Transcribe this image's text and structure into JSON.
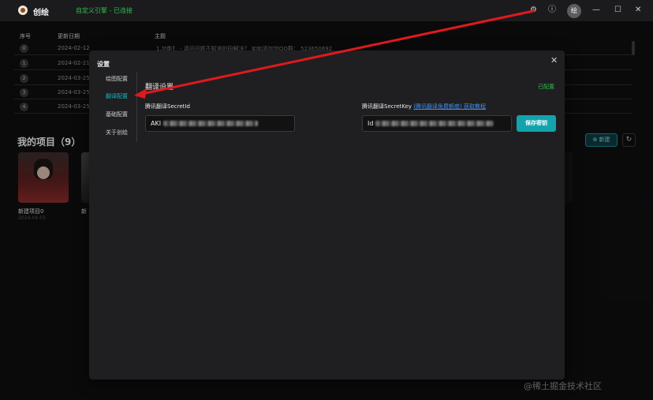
{
  "titlebar": {
    "app_title": "创绘",
    "engine_status": "自定义引擎 - 已连接",
    "avatar_label": "绘",
    "icons": [
      "gear-icon",
      "help-icon",
      "minimize-icon",
      "maximize-icon",
      "close-icon"
    ]
  },
  "table": {
    "headers": [
      "序号",
      "更新日期",
      "主题"
    ],
    "rows": [
      {
        "index": "0",
        "date": "2024-02-12",
        "topic": "1.功能】 - 请问问题不知道的码解决？ 如如添加加QQ群： 523650692"
      },
      {
        "index": "1",
        "date": "2024-02-21",
        "topic": ""
      },
      {
        "index": "2",
        "date": "2024-03-25",
        "topic": ""
      },
      {
        "index": "3",
        "date": "2024-03-25",
        "topic": ""
      },
      {
        "index": "4",
        "date": "2024-03-25",
        "topic": ""
      }
    ]
  },
  "projects": {
    "title": "我的项目（9）",
    "new_label": "新建",
    "items": [
      {
        "name": "新建项目0",
        "date": "2024-04-03"
      },
      {
        "name": "新",
        "date": ""
      }
    ]
  },
  "modal": {
    "title": "设置",
    "nav": [
      "绘图配置",
      "翻译配置",
      "基础配置",
      "关于创绘"
    ],
    "active_nav": "翻译配置",
    "section_title": "翻译设置",
    "section_status": "已配置",
    "secret_id_label": "腾讯翻译SecretId",
    "secret_id_value": "AKI",
    "secret_key_label": "腾讯翻译SecretKey",
    "secret_key_link": "(腾讯翻译免费额度) 获取教程",
    "secret_key_value": "Id",
    "save_label": "保存密钥"
  },
  "watermark": "@稀土掘金技术社区",
  "colors": {
    "accent": "#13a3ad",
    "status_green": "#2fbf4a",
    "annotation_red": "#e0191e",
    "link_blue": "#3d8ef0"
  }
}
